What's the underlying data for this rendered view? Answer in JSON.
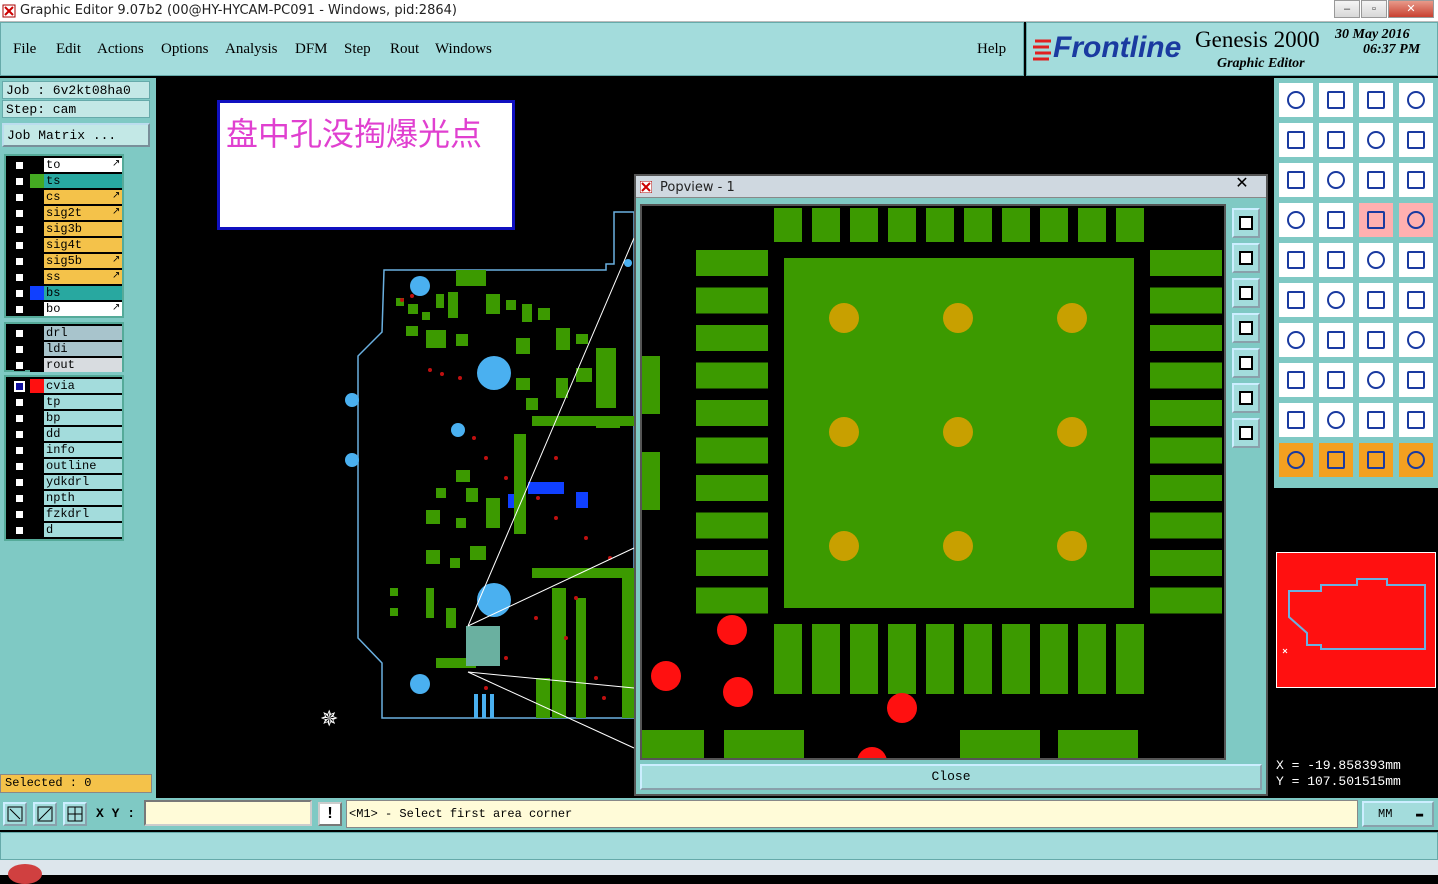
{
  "window": {
    "title": "Graphic Editor 9.07b2 (00@HY-HYCAM-PC091 - Windows, pid:2864)"
  },
  "menus": [
    {
      "label": "File"
    },
    {
      "label": "Edit"
    },
    {
      "label": "Actions"
    },
    {
      "label": "Options"
    },
    {
      "label": "Analysis"
    },
    {
      "label": "DFM"
    },
    {
      "label": "Step"
    },
    {
      "label": "Rout"
    },
    {
      "label": "Windows"
    }
  ],
  "help_label": "Help",
  "brand": {
    "logo": "Frontline",
    "product": "Genesis 2000",
    "subtitle": "Graphic Editor",
    "date": "30 May 2016",
    "time": "06:37 PM"
  },
  "job": {
    "job_line": "Job : 6v2kt08ha0",
    "step_line": "Step: cam",
    "matrix_button": "Job Matrix ..."
  },
  "layers_board": [
    {
      "name": "to",
      "color": "#ffffff",
      "swatch": "#000000",
      "flag": true
    },
    {
      "name": "ts",
      "color": "#28a8a0",
      "swatch": "#44aa22",
      "flag": false
    },
    {
      "name": "cs",
      "color": "#f4c24a",
      "swatch": "#000000",
      "flag": true
    },
    {
      "name": "sig2t",
      "color": "#f4c24a",
      "swatch": "#000000",
      "flag": true
    },
    {
      "name": "sig3b",
      "color": "#f4c24a",
      "swatch": "#000000",
      "flag": false
    },
    {
      "name": "sig4t",
      "color": "#f4c24a",
      "swatch": "#000000",
      "flag": false
    },
    {
      "name": "sig5b",
      "color": "#f4c24a",
      "swatch": "#000000",
      "flag": true
    },
    {
      "name": "ss",
      "color": "#f4c24a",
      "swatch": "#000000",
      "flag": true
    },
    {
      "name": "bs",
      "color": "#28a8a0",
      "swatch": "#1040ff",
      "flag": false
    },
    {
      "name": "bo",
      "color": "#ffffff",
      "swatch": "#000000",
      "flag": true
    }
  ],
  "layers_drill": [
    {
      "name": "drl",
      "color": "#a8c4cc",
      "swatch": "#000000"
    },
    {
      "name": "ldi",
      "color": "#a8c4cc",
      "swatch": "#000000"
    },
    {
      "name": "rout",
      "color": "#d8dce0",
      "swatch": "#000000"
    }
  ],
  "layers_misc": [
    {
      "name": "cvia",
      "color": "#a3dcdc",
      "swatch": "#ff1010",
      "active": true
    },
    {
      "name": "tp",
      "color": "#a3dcdc",
      "swatch": "#000000"
    },
    {
      "name": "bp",
      "color": "#a3dcdc",
      "swatch": "#000000"
    },
    {
      "name": "dd",
      "color": "#a3dcdc",
      "swatch": "#000000"
    },
    {
      "name": "info",
      "color": "#a3dcdc",
      "swatch": "#000000"
    },
    {
      "name": "outline",
      "color": "#a3dcdc",
      "swatch": "#000000"
    },
    {
      "name": "ydkdrl",
      "color": "#a3dcdc",
      "swatch": "#000000"
    },
    {
      "name": "npth",
      "color": "#a3dcdc",
      "swatch": "#000000"
    },
    {
      "name": "fzkdrl",
      "color": "#a3dcdc",
      "swatch": "#000000"
    },
    {
      "name": "d",
      "color": "#a3dcdc",
      "swatch": "#000000"
    }
  ],
  "selected_label": "Selected : 0",
  "note_text": "盘中孔没掏爆光点",
  "popview": {
    "title": "Popview - 1",
    "close_label": "Close"
  },
  "coords": {
    "x": "X = -19.858393mm",
    "y": "Y = 107.501515mm"
  },
  "statusbar": {
    "xy_label": "X Y :",
    "xy_value": "",
    "message": "<M1> - Select first area corner",
    "unit": "MM"
  },
  "colors": {
    "panel": "#7fc9c4",
    "menu": "#a3dcdc",
    "pad_green": "#3c9a00",
    "via_gold": "#c8a000",
    "via_red": "#ff1010",
    "board_outline": "#6ab0e0"
  }
}
